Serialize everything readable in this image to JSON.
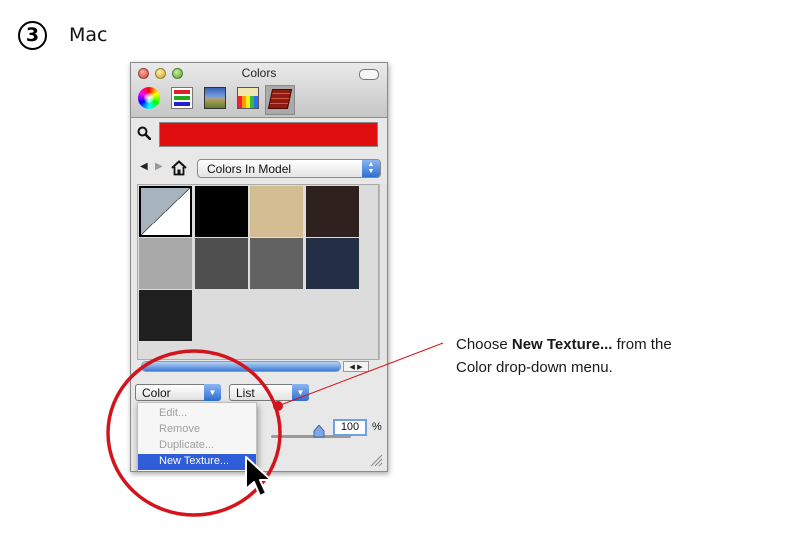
{
  "step": {
    "number": "3",
    "title": "Mac"
  },
  "window": {
    "title": "Colors",
    "toolbar_icons": [
      "color-wheel-icon",
      "color-sliders-icon",
      "image-palette-icon",
      "crayons-icon",
      "bricks-materials-icon"
    ],
    "current_color": "#e00e0e",
    "collection": "Colors In Model",
    "swatches": [
      "#a6b4bf",
      "#000000",
      "#d4bd93",
      "#2f211d",
      "#a9a9a9",
      "#4f4f4f",
      "#626262",
      "#232f44",
      "#1f1f1f"
    ],
    "color_menu_label": "Color",
    "view_menu_label": "List",
    "dropdown_items": [
      {
        "label": "Edit...",
        "enabled": false
      },
      {
        "label": "Remove",
        "enabled": false
      },
      {
        "label": "Duplicate...",
        "enabled": false
      },
      {
        "label": "New Texture...",
        "enabled": true,
        "highlighted": true
      }
    ],
    "opacity_value": "100",
    "opacity_unit": "%"
  },
  "callout": {
    "prefix": "Choose ",
    "emphasis": "New Texture...",
    "suffix": " from the",
    "line2": "Color drop-down menu."
  },
  "colors": {
    "highlight_ring": "#d4141c",
    "menu_highlight": "#2f5cd8",
    "accent_blue": "#3f7ad4"
  }
}
